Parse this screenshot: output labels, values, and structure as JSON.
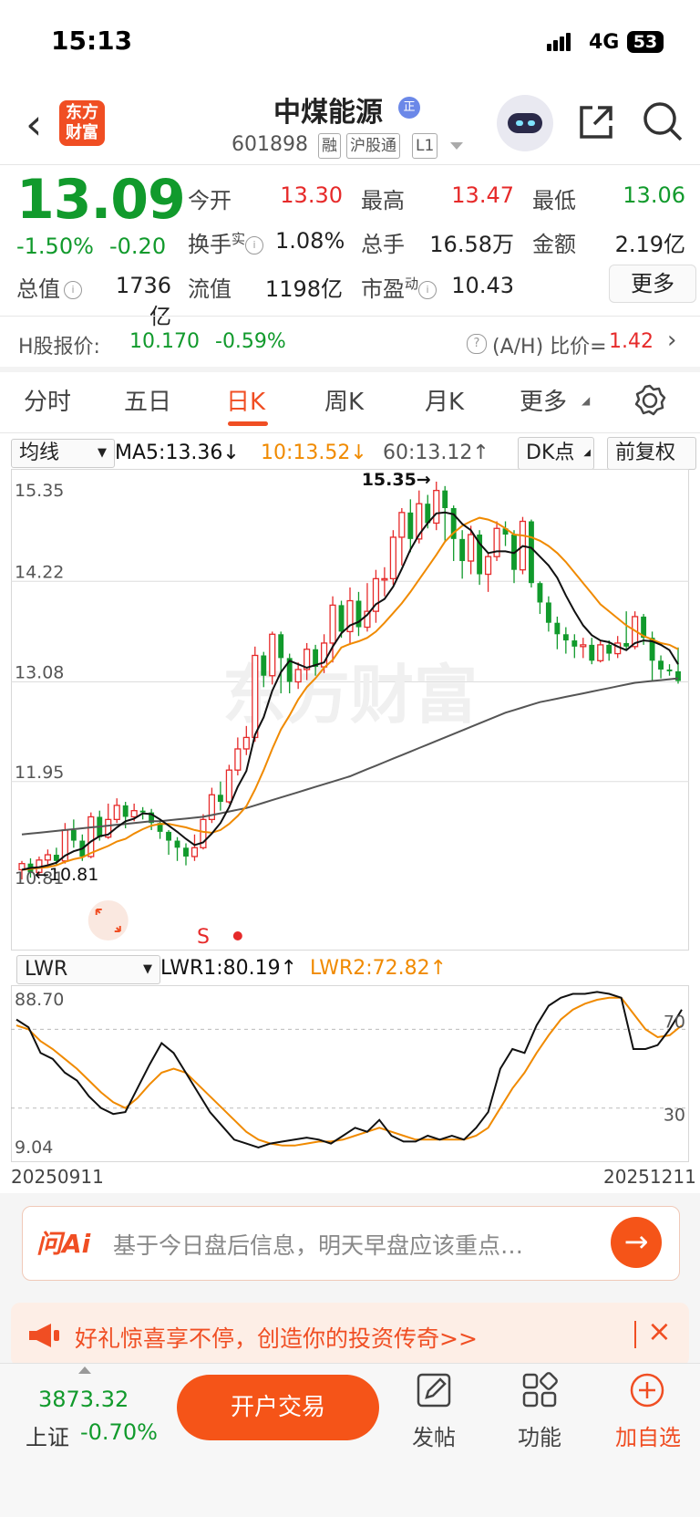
{
  "status_bar": {
    "time": "15:13",
    "network": "4G",
    "battery": "53"
  },
  "header": {
    "logo_line1": "东方",
    "logo_line2": "财富",
    "title": "中煤能源",
    "title_badge": "正",
    "code": "601898",
    "tags": [
      "融",
      "沪股通",
      "L1"
    ]
  },
  "quote": {
    "price": "13.09",
    "change_pct": "-1.50%",
    "change": "-0.20",
    "open_label": "今开",
    "open": "13.30",
    "high_label": "最高",
    "high": "13.47",
    "low_label": "最低",
    "low": "13.06",
    "turnover_label": "换手",
    "turnover_sup": "实",
    "turnover": "1.08%",
    "volume_label": "总手",
    "volume": "16.58万",
    "amount_label": "金额",
    "amount": "2.19亿",
    "mktcap_label": "总值",
    "mktcap": "1736亿",
    "float_label": "流值",
    "float": "1198亿",
    "pe_label": "市盈",
    "pe_sup": "动",
    "pe": "10.43",
    "more": "更多"
  },
  "hshare": {
    "label": "H股报价:",
    "price": "10.170",
    "change": "-0.59%",
    "ah_label": "(A/H) 比价=",
    "ah_value": "1.42"
  },
  "tabs": [
    "分时",
    "五日",
    "日K",
    "周K",
    "月K",
    "更多"
  ],
  "active_tab": 2,
  "chart_controls": {
    "indicator": "均线",
    "ma5": "MA5:13.36↓",
    "ma10": "10:13.52↓",
    "ma60": "60:13.12↑",
    "dk": "DK点",
    "adjust": "前复权",
    "lwr_select": "LWR",
    "lwr1": "LWR1:80.19↑",
    "lwr2": "LWR2:72.82↑"
  },
  "colors": {
    "up": "#e62a2a",
    "down": "#119a2c",
    "ma5": "#111111",
    "ma10": "#f08a00",
    "ma60": "#555555",
    "accent": "#f04e23"
  },
  "chart_data": [
    {
      "type": "candlestick",
      "y_ticks": [
        "15.35",
        "14.22",
        "13.08",
        "11.95",
        "10.81"
      ],
      "ylim": [
        10.81,
        15.35
      ],
      "high_marker": "15.35→",
      "low_marker": "←10.81",
      "signal_label": "S",
      "candles": [
        [
          10.95,
          11.02,
          11.05,
          10.84
        ],
        [
          11.02,
          10.92,
          11.08,
          10.86
        ],
        [
          10.92,
          11.06,
          11.1,
          10.88
        ],
        [
          11.06,
          11.12,
          11.18,
          11.0
        ],
        [
          11.12,
          11.05,
          11.2,
          11.0
        ],
        [
          11.05,
          11.4,
          11.48,
          11.02
        ],
        [
          11.4,
          11.28,
          11.52,
          11.2
        ],
        [
          11.28,
          11.1,
          11.35,
          11.05
        ],
        [
          11.1,
          11.55,
          11.6,
          11.08
        ],
        [
          11.55,
          11.32,
          11.62,
          11.28
        ],
        [
          11.32,
          11.52,
          11.7,
          11.3
        ],
        [
          11.52,
          11.68,
          11.76,
          11.48
        ],
        [
          11.68,
          11.55,
          11.72,
          11.42
        ],
        [
          11.55,
          11.62,
          11.7,
          11.5
        ],
        [
          11.62,
          11.6,
          11.66,
          11.52
        ],
        [
          11.6,
          11.48,
          11.64,
          11.4
        ],
        [
          11.48,
          11.38,
          11.52,
          11.3
        ],
        [
          11.38,
          11.28,
          11.4,
          11.12
        ],
        [
          11.28,
          11.2,
          11.32,
          11.05
        ],
        [
          11.2,
          11.1,
          11.25,
          11.0
        ],
        [
          11.1,
          11.2,
          11.35,
          11.05
        ],
        [
          11.2,
          11.52,
          11.58,
          11.18
        ],
        [
          11.52,
          11.8,
          11.88,
          11.48
        ],
        [
          11.8,
          11.72,
          11.95,
          11.62
        ],
        [
          11.72,
          12.08,
          12.14,
          11.7
        ],
        [
          12.08,
          12.32,
          12.45,
          12.02
        ],
        [
          12.32,
          12.45,
          12.58,
          12.25
        ],
        [
          12.45,
          13.38,
          13.48,
          12.4
        ],
        [
          13.38,
          13.15,
          13.42,
          13.02
        ],
        [
          13.15,
          13.62,
          13.65,
          13.05
        ],
        [
          13.62,
          13.35,
          13.65,
          12.95
        ],
        [
          13.35,
          13.08,
          13.4,
          12.95
        ],
        [
          13.08,
          13.22,
          13.3,
          13.0
        ],
        [
          13.22,
          13.45,
          13.52,
          13.1
        ],
        [
          13.45,
          13.25,
          13.5,
          13.15
        ],
        [
          13.25,
          13.52,
          13.62,
          13.18
        ],
        [
          13.52,
          13.95,
          14.05,
          13.3
        ],
        [
          13.95,
          13.65,
          14.0,
          13.58
        ],
        [
          13.65,
          14.0,
          14.15,
          13.5
        ],
        [
          14.0,
          13.7,
          14.1,
          13.6
        ],
        [
          13.7,
          13.88,
          14.2,
          13.65
        ],
        [
          13.88,
          14.25,
          14.35,
          13.75
        ],
        [
          14.25,
          14.25,
          14.38,
          14.05
        ],
        [
          14.25,
          14.72,
          14.8,
          14.18
        ],
        [
          14.72,
          15.0,
          15.05,
          14.4
        ],
        [
          15.0,
          14.7,
          15.15,
          14.55
        ],
        [
          14.7,
          15.1,
          15.25,
          14.65
        ],
        [
          15.1,
          14.88,
          15.2,
          14.82
        ],
        [
          14.88,
          15.25,
          15.35,
          14.8
        ],
        [
          15.25,
          15.05,
          15.3,
          14.68
        ],
        [
          15.05,
          14.7,
          15.08,
          14.45
        ],
        [
          14.7,
          14.45,
          14.8,
          14.25
        ],
        [
          14.45,
          14.75,
          14.85,
          14.3
        ],
        [
          14.75,
          14.3,
          14.8,
          14.18
        ],
        [
          14.3,
          14.5,
          14.55,
          14.1
        ],
        [
          14.5,
          14.82,
          14.9,
          14.45
        ],
        [
          14.82,
          14.75,
          14.9,
          14.62
        ],
        [
          14.75,
          14.35,
          14.8,
          14.2
        ],
        [
          14.35,
          14.9,
          14.95,
          14.3
        ],
        [
          14.9,
          14.2,
          14.92,
          14.15
        ],
        [
          14.2,
          13.98,
          14.22,
          13.85
        ],
        [
          13.98,
          13.75,
          14.05,
          13.65
        ],
        [
          13.75,
          13.62,
          13.82,
          13.45
        ],
        [
          13.62,
          13.55,
          13.7,
          13.4
        ],
        [
          13.55,
          13.48,
          13.62,
          13.35
        ],
        [
          13.48,
          13.5,
          13.58,
          13.35
        ],
        [
          13.5,
          13.32,
          13.58,
          13.28
        ],
        [
          13.32,
          13.5,
          13.55,
          13.3
        ],
        [
          13.5,
          13.4,
          13.55,
          13.32
        ],
        [
          13.4,
          13.52,
          13.6,
          13.35
        ],
        [
          13.52,
          13.48,
          13.88,
          13.45
        ],
        [
          13.48,
          13.82,
          13.88,
          13.45
        ],
        [
          13.82,
          13.58,
          13.85,
          13.5
        ],
        [
          13.58,
          13.32,
          13.65,
          13.1
        ],
        [
          13.32,
          13.22,
          13.38,
          13.12
        ],
        [
          13.22,
          13.2,
          13.28,
          13.15
        ],
        [
          13.2,
          13.09,
          13.47,
          13.06
        ]
      ],
      "ma5": [
        10.95,
        10.97,
        10.98,
        11.0,
        11.03,
        11.11,
        11.16,
        11.19,
        11.27,
        11.33,
        11.35,
        11.43,
        11.5,
        11.53,
        11.59,
        11.58,
        11.52,
        11.45,
        11.38,
        11.3,
        11.23,
        11.26,
        11.36,
        11.48,
        11.66,
        11.89,
        12.07,
        12.48,
        12.68,
        12.98,
        13.19,
        13.32,
        13.28,
        13.24,
        13.27,
        13.3,
        13.48,
        13.63,
        13.72,
        13.76,
        13.84,
        13.96,
        14.02,
        14.16,
        14.36,
        14.58,
        14.75,
        14.88,
        14.99,
        15.0,
        14.98,
        14.87,
        14.8,
        14.65,
        14.54,
        14.56,
        14.56,
        14.54,
        14.62,
        14.6,
        14.5,
        14.4,
        14.26,
        14.06,
        13.88,
        13.72,
        13.61,
        13.55,
        13.53,
        13.48,
        13.44,
        13.52,
        13.55,
        13.54,
        13.5,
        13.44,
        13.28
      ],
      "ma10": [
        10.95,
        10.96,
        10.97,
        10.98,
        11.0,
        11.04,
        11.07,
        11.09,
        11.14,
        11.18,
        11.22,
        11.27,
        11.3,
        11.36,
        11.41,
        11.45,
        11.47,
        11.47,
        11.45,
        11.43,
        11.4,
        11.38,
        11.37,
        11.4,
        11.47,
        11.56,
        11.67,
        11.86,
        12.08,
        12.32,
        12.54,
        12.7,
        12.88,
        13.02,
        13.12,
        13.24,
        13.33,
        13.47,
        13.51,
        13.54,
        13.58,
        13.65,
        13.75,
        13.86,
        13.97,
        14.1,
        14.24,
        14.38,
        14.52,
        14.67,
        14.77,
        14.85,
        14.9,
        14.94,
        14.92,
        14.88,
        14.82,
        14.75,
        14.74,
        14.72,
        14.68,
        14.62,
        14.54,
        14.44,
        14.32,
        14.2,
        14.08,
        13.96,
        13.88,
        13.8,
        13.72,
        13.66,
        13.6,
        13.56,
        13.52,
        13.5,
        13.45
      ],
      "ma60": [
        11.35,
        11.36,
        11.37,
        11.38,
        11.39,
        11.4,
        11.41,
        11.42,
        11.43,
        11.44,
        11.45,
        11.46,
        11.47,
        11.48,
        11.49,
        11.5,
        11.5,
        11.51,
        11.52,
        11.53,
        11.54,
        11.55,
        11.57,
        11.59,
        11.61,
        11.63,
        11.65,
        11.68,
        11.71,
        11.74,
        11.77,
        11.8,
        11.83,
        11.86,
        11.89,
        11.92,
        11.95,
        11.98,
        12.01,
        12.05,
        12.09,
        12.13,
        12.17,
        12.21,
        12.25,
        12.29,
        12.33,
        12.37,
        12.41,
        12.45,
        12.49,
        12.53,
        12.57,
        12.61,
        12.65,
        12.69,
        12.73,
        12.76,
        12.79,
        12.82,
        12.85,
        12.87,
        12.89,
        12.91,
        12.93,
        12.95,
        12.97,
        12.99,
        13.01,
        13.03,
        13.05,
        13.07,
        13.08,
        13.09,
        13.1,
        13.11,
        13.12
      ]
    },
    {
      "type": "line",
      "y_ticks": [
        "88.70",
        "9.04"
      ],
      "ylim": [
        9.04,
        88.7
      ],
      "ref_lines": [
        70,
        30
      ],
      "x_labels": [
        "20250911",
        "20251211"
      ],
      "series": [
        {
          "name": "LWR1",
          "values": [
            75,
            71,
            58,
            55,
            48,
            44,
            36,
            30,
            27,
            28,
            40,
            52,
            63,
            58,
            48,
            38,
            28,
            21,
            14,
            12,
            10,
            12,
            13,
            14,
            15,
            14,
            12,
            16,
            20,
            18,
            24,
            16,
            13,
            13,
            16,
            14,
            16,
            14,
            20,
            28,
            50,
            60,
            58,
            72,
            82,
            86,
            88,
            88,
            89,
            88,
            86,
            60,
            60,
            62,
            70,
            80
          ]
        },
        {
          "name": "LWR2",
          "values": [
            72,
            70,
            64,
            60,
            55,
            50,
            44,
            38,
            33,
            30,
            35,
            42,
            48,
            50,
            48,
            42,
            36,
            30,
            24,
            18,
            14,
            12,
            11,
            11,
            12,
            13,
            13,
            14,
            16,
            18,
            20,
            18,
            16,
            14,
            14,
            14,
            14,
            14,
            16,
            20,
            30,
            40,
            48,
            58,
            67,
            75,
            80,
            83,
            85,
            86,
            86,
            78,
            70,
            66,
            67,
            72
          ]
        }
      ]
    }
  ],
  "watermark": "东方财富",
  "ai_box": {
    "brand": "问Ai",
    "placeholder": "基于今日盘后信息，明天早盘应该重点…",
    "go": "→"
  },
  "banner": {
    "text": "好礼惊喜享不停，创造你的投资传奇>>",
    "close": "×"
  },
  "bottom_bar": {
    "index_value": "3873.32",
    "index_name": "上证",
    "index_change": "-0.70%",
    "trade_button": "开户交易",
    "post": "发帖",
    "functions": "功能",
    "add_watch": "加自选"
  }
}
